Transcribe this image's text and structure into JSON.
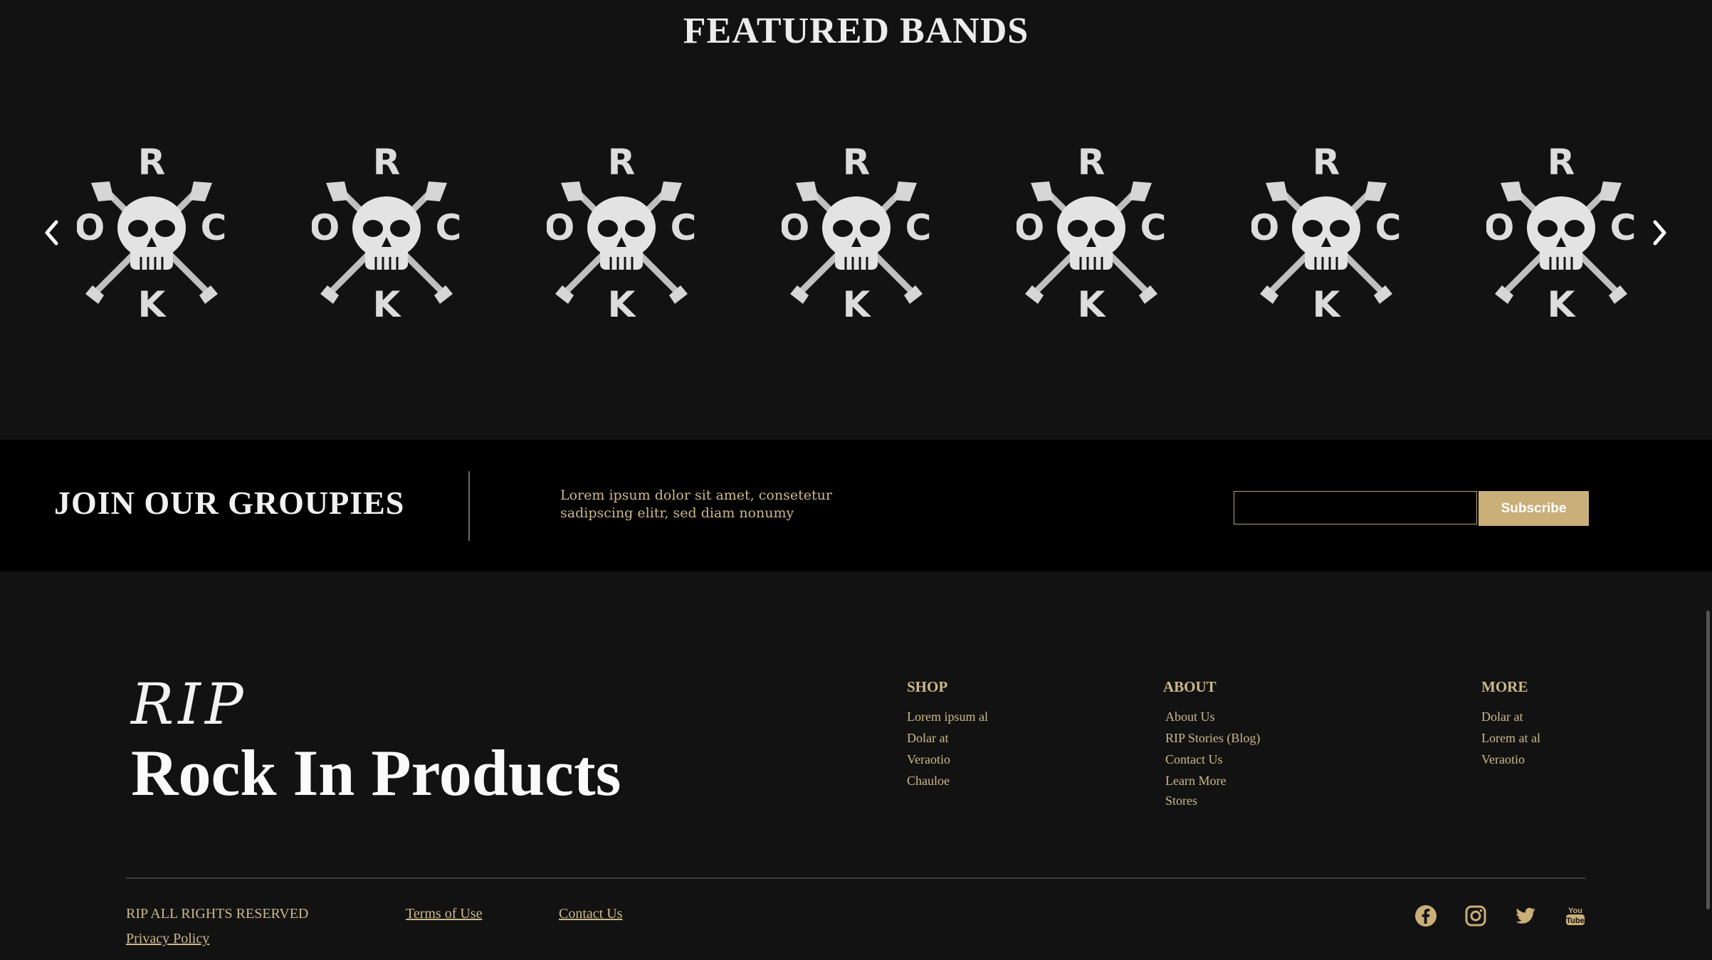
{
  "featured": {
    "title": "FEATURED BANDS",
    "band_logos": [
      {
        "letters": {
          "top": "R",
          "left": "O",
          "right": "C",
          "bottom": "K"
        }
      },
      {
        "letters": {
          "top": "R",
          "left": "O",
          "right": "C",
          "bottom": "K"
        }
      },
      {
        "letters": {
          "top": "R",
          "left": "O",
          "right": "C",
          "bottom": "K"
        }
      },
      {
        "letters": {
          "top": "R",
          "left": "O",
          "right": "C",
          "bottom": "K"
        }
      },
      {
        "letters": {
          "top": "R",
          "left": "O",
          "right": "C",
          "bottom": "K"
        }
      },
      {
        "letters": {
          "top": "R",
          "left": "O",
          "right": "C",
          "bottom": "K"
        }
      },
      {
        "letters": {
          "top": "R",
          "left": "O",
          "right": "C",
          "bottom": "K"
        }
      }
    ],
    "prev_icon": "chevron-left-icon",
    "next_icon": "chevron-right-icon"
  },
  "join": {
    "title": "JOIN OUR GROUPIES",
    "text_line1": "Lorem ipsum dolor sit amet, consetetur",
    "text_line2": "sadipscing elitr, sed diam nonumy",
    "email_value": "",
    "subscribe_label": "Subscribe"
  },
  "footer": {
    "brand_script": "RIP",
    "brand_name": "Rock In Products",
    "columns": [
      {
        "heading": "SHOP",
        "links": [
          "Lorem ipsum al",
          "Dolar at",
          "Veraotio",
          "Chauloe"
        ]
      },
      {
        "heading": "ABOUT",
        "links": [
          "About Us",
          "RIP Stories (Blog)",
          "Contact Us",
          "Learn More",
          "Stores"
        ]
      },
      {
        "heading": "MORE",
        "links": [
          "Dolar at",
          "Lorem at al",
          "Veraotio"
        ]
      }
    ],
    "rights": "RIP ALL RIGHTS RESERVED",
    "terms": "Terms of Use",
    "contact": "Contact Us",
    "privacy": "Privacy Policy",
    "social_icons": [
      "facebook-icon",
      "instagram-icon",
      "twitter-icon",
      "youtube-icon"
    ],
    "youtube_logo_text": "You Tube"
  },
  "colors": {
    "background": "#121212",
    "join_background": "#000000",
    "accent_gold": "#c9af78",
    "link_gold": "#cdb98a"
  }
}
